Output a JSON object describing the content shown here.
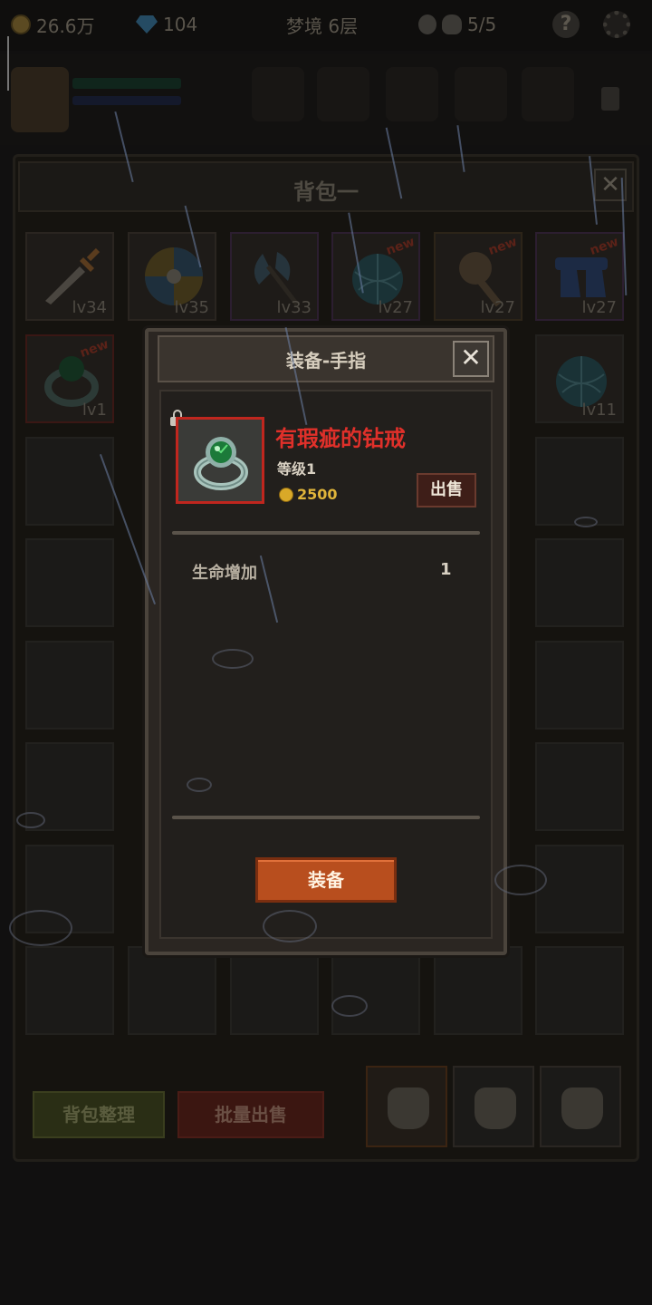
{
  "topbar": {
    "gold": "26.6万",
    "gems": "104",
    "floor": "梦境 6层",
    "keys": "5/5"
  },
  "bag": {
    "title": "背包一",
    "close": "✕",
    "items": [
      {
        "icon": "sword-icon",
        "level": "lv34",
        "is_new": false
      },
      {
        "icon": "round-shield-icon",
        "level": "lv35",
        "is_new": false
      },
      {
        "icon": "axe-icon",
        "level": "lv33",
        "is_new": false
      },
      {
        "icon": "orb-net-icon",
        "level": "lv27",
        "is_new": true,
        "new_label": "new"
      },
      {
        "icon": "skull-club-icon",
        "level": "lv27",
        "is_new": true,
        "new_label": "new"
      },
      {
        "icon": "blue-boots-icon",
        "level": "lv27",
        "is_new": true,
        "new_label": "new"
      },
      {
        "icon": "emerald-ring-icon",
        "level": "lv1",
        "is_new": true,
        "new_label": "new"
      },
      {
        "icon": "orb-net-icon",
        "level": "lv11",
        "is_new": false
      }
    ],
    "sort_button": "背包整理",
    "bulk_sell_button": "批量出售"
  },
  "modal": {
    "title": "装备-手指",
    "close": "✕",
    "item_name": "有瑕疵的钻戒",
    "item_level": "等级1",
    "price": "2500",
    "sell_button": "出售",
    "stats": [
      {
        "name": "生命增加",
        "value": "1"
      }
    ],
    "equip_button": "装备"
  },
  "colors": {
    "item_name_red": "#e0302a",
    "equip_orange": "#b84e1e",
    "gold_yellow": "#e0b53a"
  }
}
